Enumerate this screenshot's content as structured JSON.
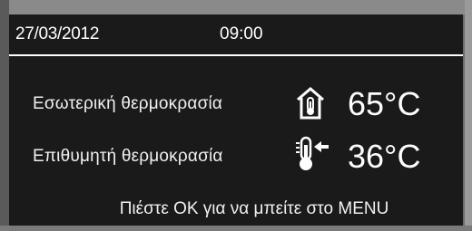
{
  "header": {
    "date": "27/03/2012",
    "time": "09:00"
  },
  "rows": [
    {
      "label": "Εσωτερική θερμοκρασία",
      "value": "65°C",
      "icon": "house-thermometer-icon"
    },
    {
      "label": "Επιθυμητή θερμοκρασία",
      "value": "36°C",
      "icon": "thermometer-arrow-icon"
    }
  ],
  "footer": {
    "hint": "Πιέστε ΟΚ για να μπείτε στο MENU"
  }
}
